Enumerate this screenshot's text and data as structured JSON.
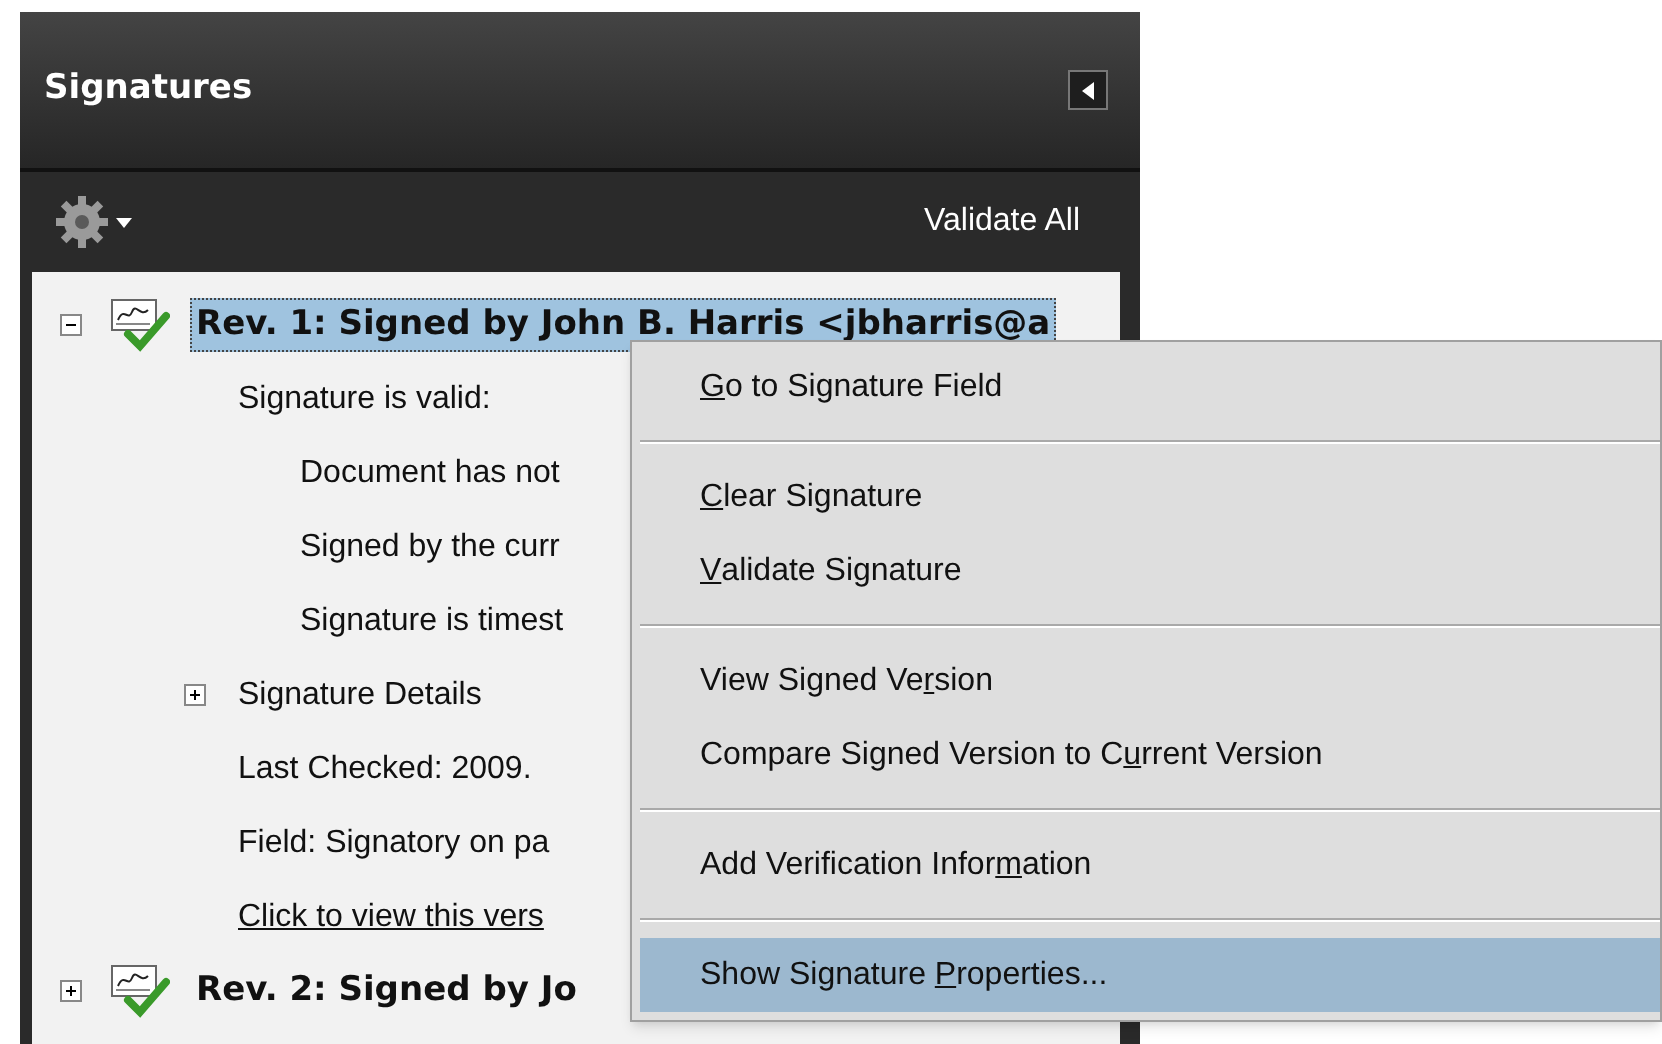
{
  "panel": {
    "title": "Signatures",
    "toolbar": {
      "validate_all": "Validate All"
    }
  },
  "tree": [
    {
      "label": "Rev. 1: Signed by John B. Harris <jbharris@a",
      "kind": "signature",
      "expanded": true,
      "selected": true,
      "children": [
        {
          "label": "Signature is valid:",
          "kind": "text",
          "children": [
            {
              "label": "Document has not",
              "kind": "text"
            },
            {
              "label": "Signed by the curr",
              "kind": "text"
            },
            {
              "label": "Signature is timest",
              "kind": "text"
            }
          ]
        },
        {
          "label": "Signature Details",
          "kind": "group",
          "expanded": false
        },
        {
          "label": "Last Checked: 2009.",
          "kind": "text"
        },
        {
          "label": "Field: Signatory on pa",
          "kind": "text"
        },
        {
          "label": "Click to view this vers",
          "kind": "link"
        }
      ]
    },
    {
      "label": "Rev. 2: Signed by Jo",
      "kind": "signature",
      "expanded": false,
      "selected": false
    }
  ],
  "context_menu": [
    {
      "kind": "item",
      "key": "G",
      "after": "o to Signature Field",
      "selected": false
    },
    {
      "kind": "separator"
    },
    {
      "kind": "item",
      "key": "C",
      "after": "lear Signature",
      "selected": false
    },
    {
      "kind": "item",
      "key": "V",
      "after": "alidate Signature",
      "selected": false
    },
    {
      "kind": "separator"
    },
    {
      "kind": "item",
      "before": "View Signed Ve",
      "key": "r",
      "after": "sion",
      "selected": false
    },
    {
      "kind": "item",
      "before": "Compare Signed Version to C",
      "key": "u",
      "after": "rrent Version",
      "selected": false
    },
    {
      "kind": "separator"
    },
    {
      "kind": "item",
      "before": "Add Verification Infor",
      "key": "m",
      "after": "ation",
      "selected": false
    },
    {
      "kind": "separator"
    },
    {
      "kind": "item",
      "before": "Show Signature ",
      "key": "P",
      "after": "roperties...",
      "selected": true
    }
  ]
}
